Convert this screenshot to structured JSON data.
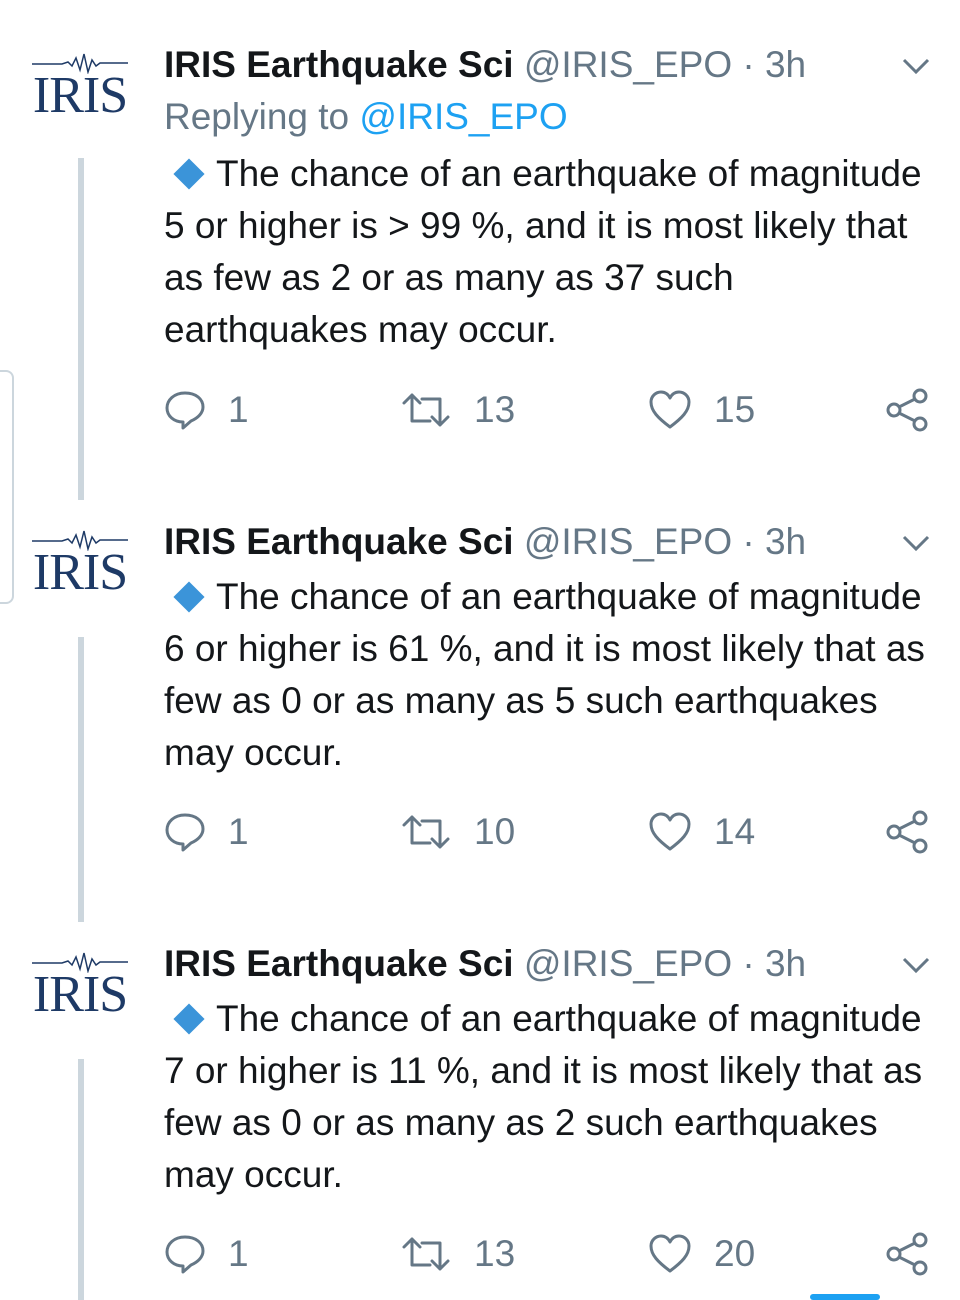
{
  "tweets": [
    {
      "name": "IRIS Earthquake Sci",
      "handle": "@IRIS_EPO",
      "separator": "·",
      "time": "3h",
      "replying_prefix": "Replying to ",
      "replying_mention": "@IRIS_EPO",
      "avatar_text": "IRIS",
      "text": "The chance of an earthquake of magnitude 5 or higher is > 99 %, and it is most likely that as few as 2 or as many as 37 such earthquakes may occur.",
      "replies": "1",
      "retweets": "13",
      "likes": "15"
    },
    {
      "name": "IRIS Earthquake Sci",
      "handle": "@IRIS_EPO",
      "separator": "·",
      "time": "3h",
      "avatar_text": "IRIS",
      "text": "The chance of an earthquake of magnitude 6 or higher is 61 %, and it is most likely that as few as 0 or as many as 5 such earthquakes may occur.",
      "replies": "1",
      "retweets": "10",
      "likes": "14"
    },
    {
      "name": "IRIS Earthquake Sci",
      "handle": "@IRIS_EPO",
      "separator": "·",
      "time": "3h",
      "avatar_text": "IRIS",
      "text": "The chance of an earthquake of magnitude 7 or higher is 11 %, and it is most likely that as few as 0 or as many as 2 such earthquakes may occur.",
      "replies": "1",
      "retweets": "13",
      "likes": "20"
    }
  ],
  "icons": {
    "reply": "reply-icon",
    "retweet": "retweet-icon",
    "like": "heart-icon",
    "share": "share-icon",
    "caret": "chevron-down-icon",
    "bullet": "blue-diamond-icon"
  },
  "colors": {
    "text": "#14171a",
    "secondary": "#657786",
    "link": "#1da1f2",
    "thread_line": "#ccd6dd",
    "diamond": "#3b94d9",
    "logo": "#1e3a66"
  }
}
